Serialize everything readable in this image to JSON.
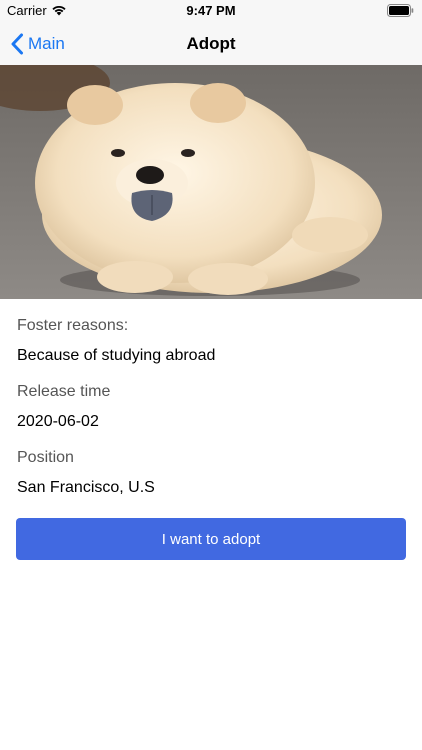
{
  "status_bar": {
    "carrier": "Carrier",
    "time": "9:47 PM"
  },
  "nav": {
    "back_label": "Main",
    "title": "Adopt"
  },
  "details": {
    "foster_reasons_label": "Foster reasons:",
    "foster_reasons_value": "Because of studying abroad",
    "release_time_label": "Release time",
    "release_time_value": "2020-06-02",
    "position_label": "Position",
    "position_value": "San Francisco, U.S"
  },
  "adopt_button": {
    "label": "I want to adopt"
  },
  "colors": {
    "accent": "#1b77f2",
    "button": "#4169e1"
  }
}
